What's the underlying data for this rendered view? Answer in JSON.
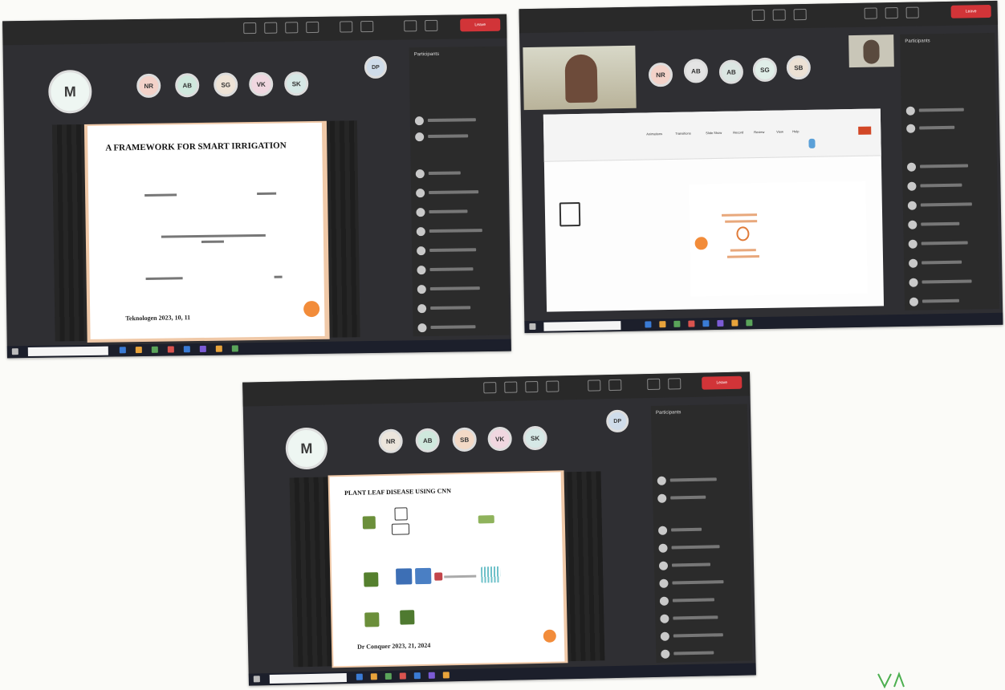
{
  "shot1": {
    "presenter_initial": "M",
    "participant_initials": [
      "NR",
      "AB",
      "SG",
      "VK",
      "SK"
    ],
    "extra_initial": "DP",
    "participants_title": "Participants",
    "leave_label": "Leave",
    "slide_title": "A FRAMEWORK FOR SMART IRRIGATION",
    "slide_footer": "Teknologen 2023, 10, 11"
  },
  "shot2": {
    "participant_initials": [
      "NR",
      "AB",
      "AB",
      "SG",
      "SB"
    ],
    "participants_title": "Participants",
    "leave_label": "Leave",
    "ribbon_tabs": [
      "Animations",
      "Transitions",
      "Slide Show",
      "Record",
      "Review",
      "View",
      "Help"
    ]
  },
  "shot3": {
    "presenter_initial": "M",
    "participant_initials": [
      "NR",
      "AB",
      "SB",
      "VK",
      "SK"
    ],
    "extra_initial": "DP",
    "participants_title": "Participants",
    "leave_label": "Leave",
    "slide_title": "PLANT LEAF DISEASE USING CNN",
    "slide_footer": "Dr Conquer 2023, 21, 2024"
  },
  "colors": {
    "teams_bg": "#2f2f33",
    "leave_red": "#d13438",
    "accent_orange": "#f28c3a",
    "taskbar": "#1c1f2b"
  }
}
